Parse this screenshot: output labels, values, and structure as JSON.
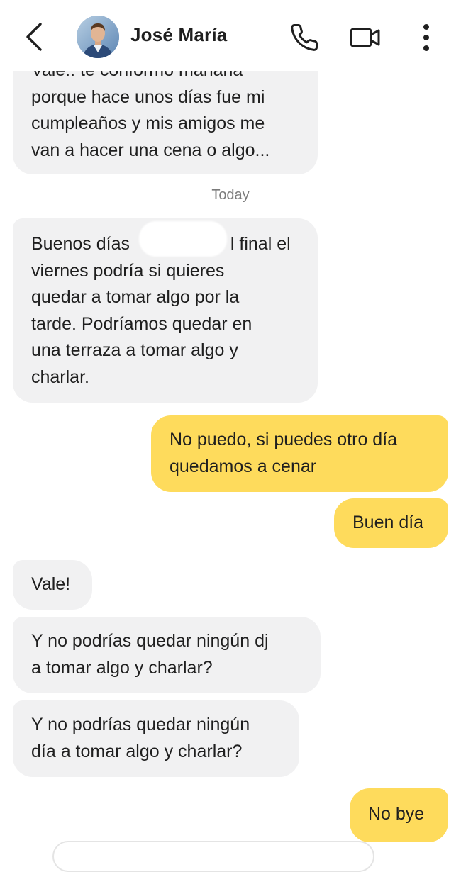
{
  "header": {
    "contact_name": "José María"
  },
  "icons": {
    "back": "chevron-left-icon",
    "call": "phone-icon",
    "video": "video-camera-icon",
    "menu": "more-vertical-icon"
  },
  "colors": {
    "incoming_bubble": "#f1f1f2",
    "outgoing_bubble": "#fedb5c",
    "date_text": "#7b7b7b"
  },
  "messages": {
    "m1_l1": "Vale.. te conformo mañana",
    "m1_l2": "porque hace unos días fue mi",
    "m1_l3": "cumpleaños y mis amigos me",
    "m1_l4": "van a hacer una cena o algo...",
    "date": "Today",
    "m2_l1a": "Buenos días",
    "m2_l1b": "l final el",
    "m2_l2": "viernes podría si quieres",
    "m2_l3": "quedar a tomar algo por la",
    "m2_l4": "tarde. Podríamos quedar en",
    "m2_l5": "una terraza a tomar algo y",
    "m2_l6": "charlar.",
    "m3_l1": "No puedo, si puedes otro día",
    "m3_l2": "quedamos a cenar",
    "m4": "Buen día",
    "m5": "Vale!",
    "m6_l1": "Y no podrías quedar ningún dj",
    "m6_l2": "a tomar algo y charlar?",
    "m7_l1": "Y no podrías quedar ningún",
    "m7_l2": "día a tomar algo y charlar?",
    "m8": "No bye"
  }
}
